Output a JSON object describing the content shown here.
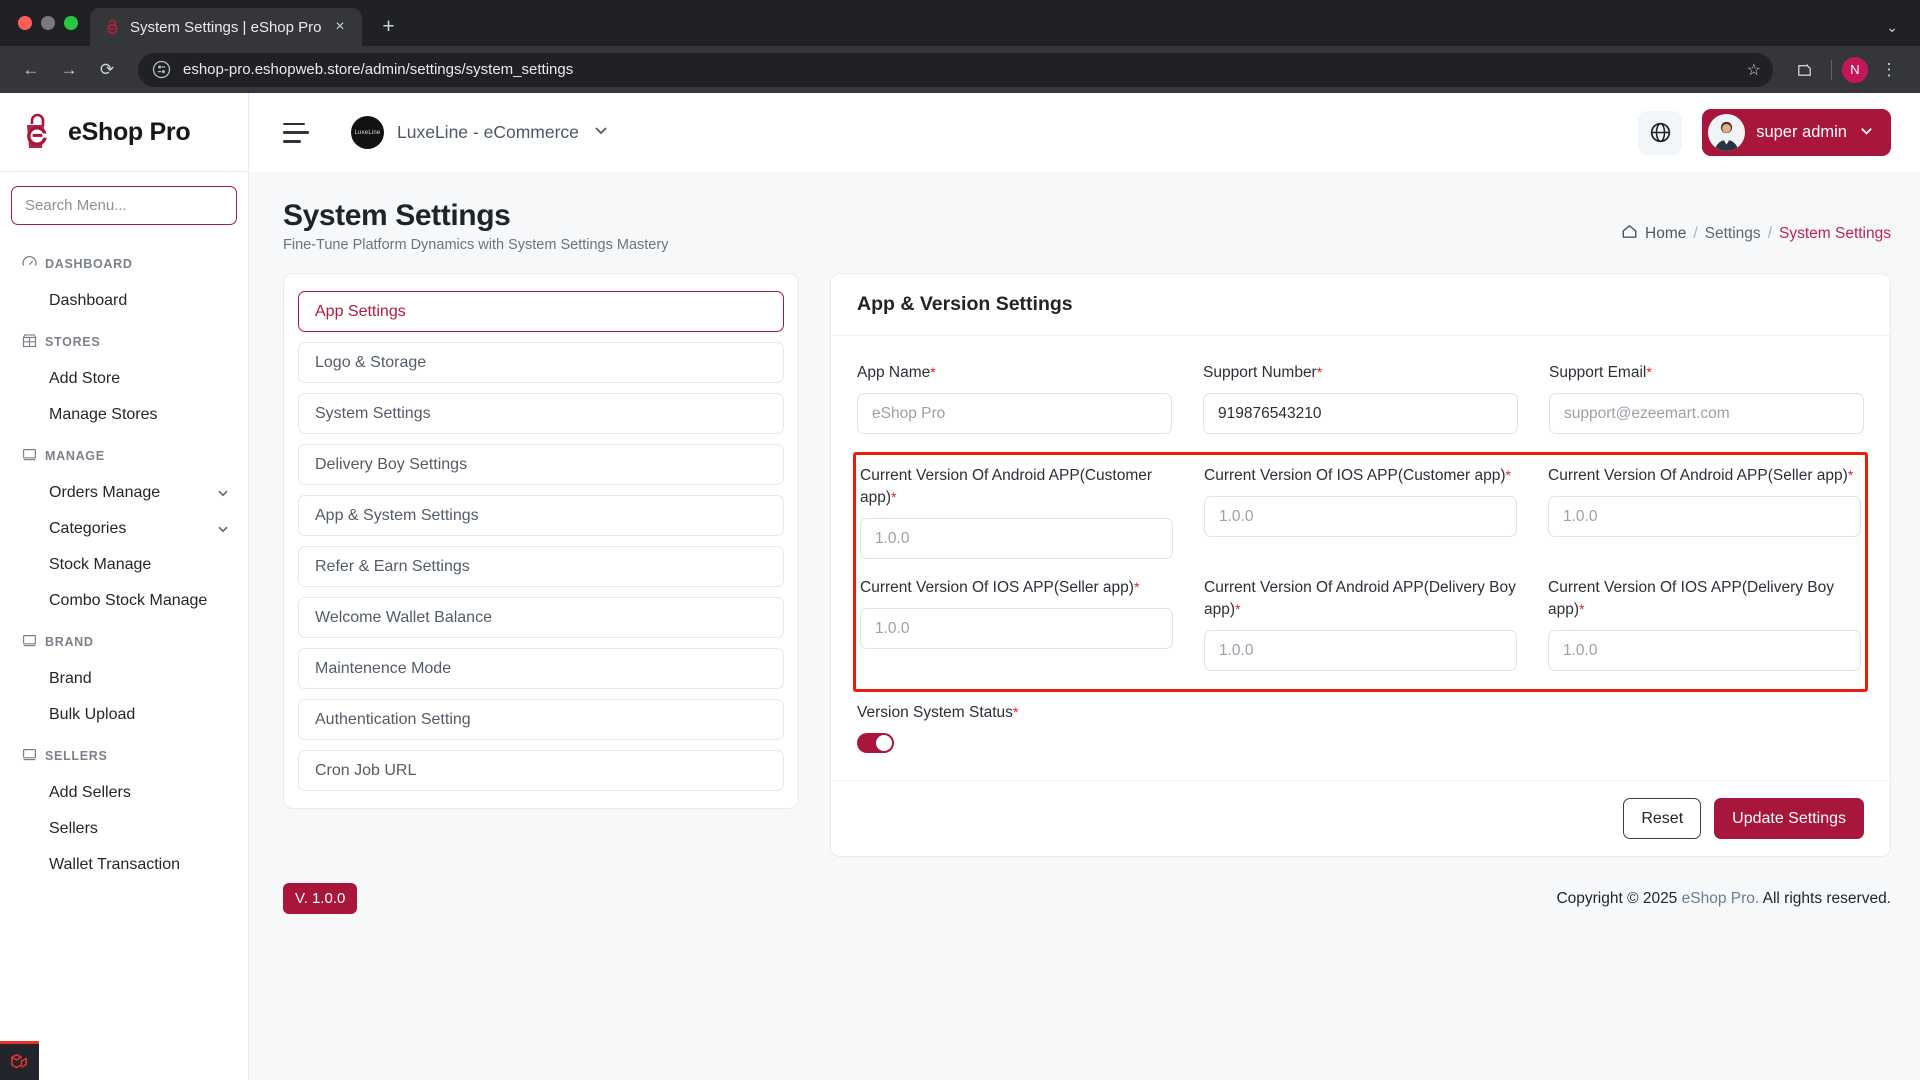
{
  "browser": {
    "tab_title": "System Settings | eShop Pro",
    "tab_favicon_name": "eshop-favicon",
    "new_tab_label": "+",
    "close_label": "×",
    "back_label": "←",
    "forward_label": "→",
    "reload_label": "⟳",
    "url": "eshop-pro.eshopweb.store/admin/settings/system_settings",
    "star_label": "☆",
    "profile_initial": "N",
    "menu_label": "⋮",
    "collapse_label": "⌄"
  },
  "sidebar": {
    "brand": "eShop Pro",
    "search_placeholder": "Search Menu...",
    "sections": [
      {
        "label": "DASHBOARD",
        "icon": "gauge-icon",
        "items": [
          {
            "label": "Dashboard",
            "expandable": false
          }
        ]
      },
      {
        "label": "STORES",
        "icon": "store-icon",
        "items": [
          {
            "label": "Add Store",
            "expandable": false
          },
          {
            "label": "Manage Stores",
            "expandable": false
          }
        ]
      },
      {
        "label": "MANAGE",
        "icon": "monitor-icon",
        "items": [
          {
            "label": "Orders Manage",
            "expandable": true
          },
          {
            "label": "Categories",
            "expandable": true
          },
          {
            "label": "Stock Manage",
            "expandable": false
          },
          {
            "label": "Combo Stock Manage",
            "expandable": false
          }
        ]
      },
      {
        "label": "BRAND",
        "icon": "monitor-icon",
        "items": [
          {
            "label": "Brand",
            "expandable": false
          },
          {
            "label": "Bulk Upload",
            "expandable": false
          }
        ]
      },
      {
        "label": "SELLERS",
        "icon": "monitor-icon",
        "items": [
          {
            "label": "Add Sellers",
            "expandable": false
          },
          {
            "label": "Sellers",
            "expandable": false
          },
          {
            "label": "Wallet Transaction",
            "expandable": false
          }
        ]
      }
    ]
  },
  "topbar": {
    "store_name": "LuxeLine - eCommerce",
    "store_avatar_text": "LuxeLine",
    "user_name": "super admin"
  },
  "page": {
    "title": "System Settings",
    "subtitle": "Fine-Tune Platform Dynamics with System Settings Mastery",
    "breadcrumb": {
      "home": "Home",
      "sep1": "/",
      "middle": "Settings",
      "sep2": "/",
      "current": "System Settings"
    }
  },
  "settings_tabs": [
    {
      "label": "App Settings",
      "active": true
    },
    {
      "label": "Logo & Storage",
      "active": false
    },
    {
      "label": "System Settings",
      "active": false
    },
    {
      "label": "Delivery Boy Settings",
      "active": false
    },
    {
      "label": "App & System Settings",
      "active": false
    },
    {
      "label": "Refer & Earn Settings",
      "active": false
    },
    {
      "label": "Welcome Wallet Balance",
      "active": false
    },
    {
      "label": "Maintenence Mode",
      "active": false
    },
    {
      "label": "Authentication Setting",
      "active": false
    },
    {
      "label": "Cron Job URL",
      "active": false
    }
  ],
  "form": {
    "heading": "App & Version Settings",
    "required_mark": "*",
    "row1": [
      {
        "label": "App Name",
        "required": true,
        "value": "",
        "placeholder": "eShop Pro"
      },
      {
        "label": "Support Number",
        "required": true,
        "value": "919876543210",
        "placeholder": ""
      },
      {
        "label": "Support Email",
        "required": true,
        "value": "",
        "placeholder": "support@ezeemart.com"
      }
    ],
    "version_fields": [
      {
        "label": "Current Version Of Android APP(Customer app)",
        "required": true,
        "value": "",
        "placeholder": "1.0.0"
      },
      {
        "label": "Current Version Of IOS APP(Customer app)",
        "required": true,
        "value": "",
        "placeholder": "1.0.0"
      },
      {
        "label": "Current Version Of Android APP(Seller app)",
        "required": true,
        "value": "",
        "placeholder": "1.0.0"
      },
      {
        "label": "Current Version Of IOS APP(Seller app)",
        "required": true,
        "value": "",
        "placeholder": "1.0.0"
      },
      {
        "label": "Current Version Of Android APP(Delivery Boy app)",
        "required": true,
        "value": "",
        "placeholder": "1.0.0"
      },
      {
        "label": "Current Version Of IOS APP(Delivery Boy app)",
        "required": true,
        "value": "",
        "placeholder": "1.0.0"
      }
    ],
    "toggle": {
      "label": "Version System Status",
      "required": true,
      "on": true
    },
    "reset_label": "Reset",
    "update_label": "Update Settings"
  },
  "footer": {
    "version_badge": "V. 1.0.0",
    "copyright_prefix": "Copyright © 2025 ",
    "copyright_link": "eShop Pro.",
    "copyright_suffix": " All rights reserved."
  },
  "colors": {
    "brand_red": "#a8163b",
    "highlight_red": "#ef1b0e",
    "required_red": "#e02020"
  }
}
